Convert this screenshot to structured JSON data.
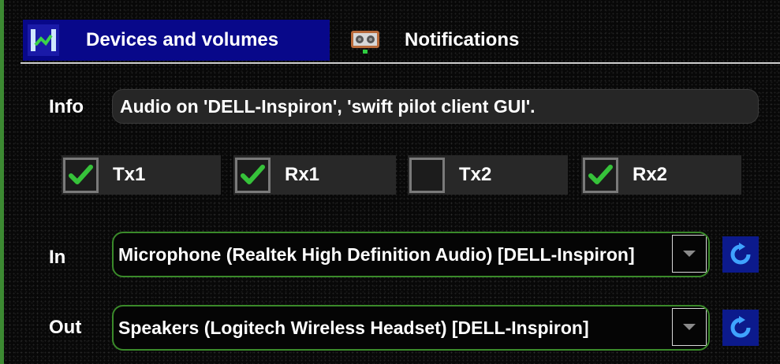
{
  "tabs": [
    {
      "label": "Devices and volumes",
      "active": true,
      "icon": "equalizer-icon"
    },
    {
      "label": "Notifications",
      "active": false,
      "icon": "speaker-icon"
    }
  ],
  "info": {
    "label": "Info",
    "value": "Audio on 'DELL-Inspiron', 'swift pilot client GUI'."
  },
  "channels": [
    {
      "label": "Tx1",
      "checked": true
    },
    {
      "label": "Rx1",
      "checked": true
    },
    {
      "label": "Tx2",
      "checked": false
    },
    {
      "label": "Rx2",
      "checked": true
    }
  ],
  "input_device": {
    "label": "In",
    "selected": "Microphone (Realtek High Definition Audio) [DELL-Inspiron]"
  },
  "output_device": {
    "label": "Out",
    "selected": "Speakers (Logitech Wireless Headset) [DELL-Inspiron]"
  },
  "colors": {
    "active_tab": "#08088a",
    "check_mark": "#36c23a",
    "combo_border": "#3a8a2a",
    "refresh_button": "#0c1a8c"
  }
}
